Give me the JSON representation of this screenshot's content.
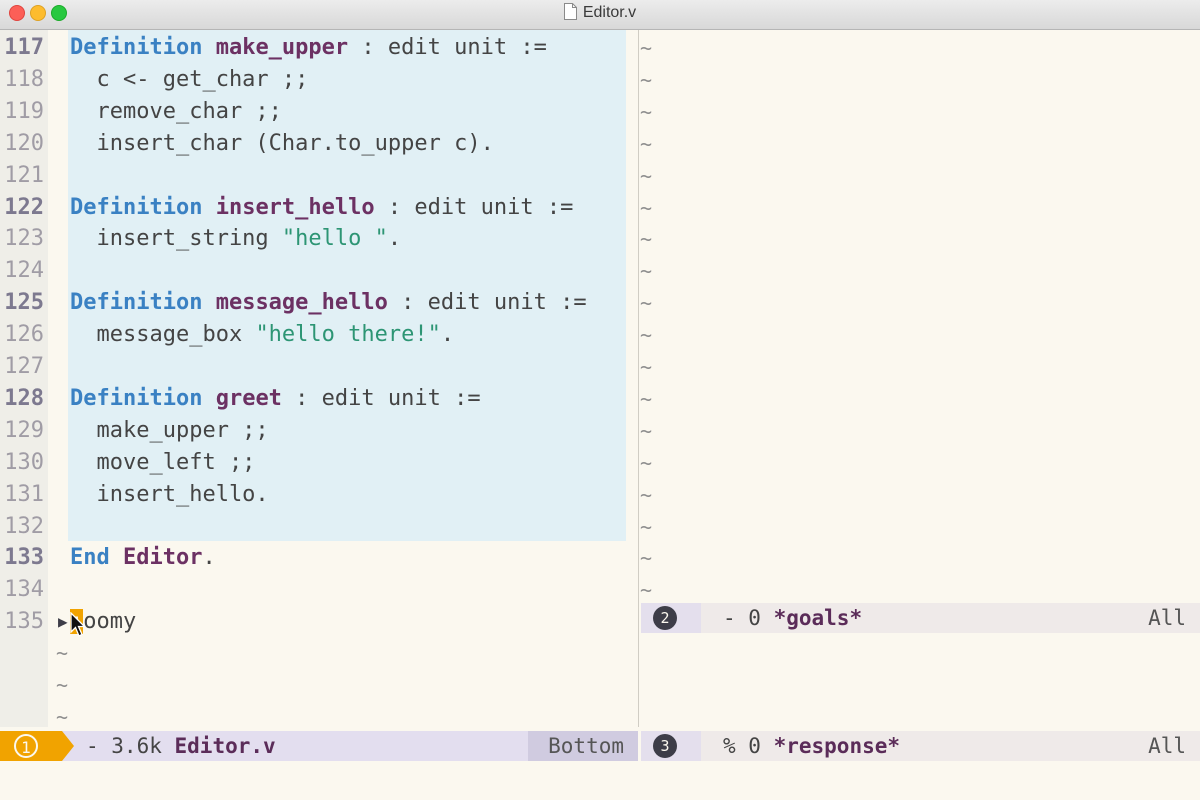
{
  "window": {
    "title": "Editor.v"
  },
  "editor": {
    "lines": [
      {
        "num": "117",
        "bold": true,
        "parts": [
          [
            "kw",
            "Definition"
          ],
          [
            "",
            " "
          ],
          [
            "nm",
            "make_upper"
          ],
          [
            "",
            " : edit unit :="
          ]
        ]
      },
      {
        "num": "118",
        "bold": false,
        "parts": [
          [
            "",
            "  c <- get_char ;;"
          ]
        ]
      },
      {
        "num": "119",
        "bold": false,
        "parts": [
          [
            "",
            "  remove_char ;;"
          ]
        ]
      },
      {
        "num": "120",
        "bold": false,
        "parts": [
          [
            "",
            "  insert_char (Char.to_upper c)."
          ]
        ]
      },
      {
        "num": "121",
        "bold": false,
        "parts": []
      },
      {
        "num": "122",
        "bold": true,
        "parts": [
          [
            "kw",
            "Definition"
          ],
          [
            "",
            " "
          ],
          [
            "nm",
            "insert_hello"
          ],
          [
            "",
            " : edit unit :="
          ]
        ]
      },
      {
        "num": "123",
        "bold": false,
        "parts": [
          [
            "",
            "  insert_string "
          ],
          [
            "str",
            "\"hello \""
          ],
          [
            "",
            "."
          ]
        ]
      },
      {
        "num": "124",
        "bold": false,
        "parts": []
      },
      {
        "num": "125",
        "bold": true,
        "parts": [
          [
            "kw",
            "Definition"
          ],
          [
            "",
            " "
          ],
          [
            "nm",
            "message_hello"
          ],
          [
            "",
            " : edit unit :="
          ]
        ]
      },
      {
        "num": "126",
        "bold": false,
        "parts": [
          [
            "",
            "  message_box "
          ],
          [
            "str",
            "\"hello there!\""
          ],
          [
            "",
            "."
          ]
        ]
      },
      {
        "num": "127",
        "bold": false,
        "parts": []
      },
      {
        "num": "128",
        "bold": true,
        "parts": [
          [
            "kw",
            "Definition"
          ],
          [
            "",
            " "
          ],
          [
            "nm",
            "greet"
          ],
          [
            "",
            " : edit unit :="
          ]
        ]
      },
      {
        "num": "129",
        "bold": false,
        "parts": [
          [
            "",
            "  make_upper ;;"
          ]
        ]
      },
      {
        "num": "130",
        "bold": false,
        "parts": [
          [
            "",
            "  move_left ;;"
          ]
        ]
      },
      {
        "num": "131",
        "bold": false,
        "parts": [
          [
            "",
            "  insert_hello."
          ]
        ]
      },
      {
        "num": "132",
        "bold": false,
        "parts": []
      },
      {
        "num": "133",
        "bold": true,
        "parts": [
          [
            "kw",
            "End"
          ],
          [
            "",
            " "
          ],
          [
            "nm",
            "Editor"
          ],
          [
            "",
            "."
          ]
        ]
      },
      {
        "num": "134",
        "bold": false,
        "parts": []
      },
      {
        "num": "135",
        "bold": false,
        "parts": [
          [
            "cursor",
            ":"
          ],
          [
            "",
            "oomy"
          ]
        ]
      }
    ],
    "empty_marker": "~"
  },
  "modeline_left": {
    "window_number": "1",
    "info": "- 3.6k",
    "buffer_name": "Editor.v",
    "position": "Bottom"
  },
  "modeline_goals": {
    "window_number": "2",
    "info": "- 0",
    "buffer_name": "*goals*",
    "position": "All"
  },
  "modeline_response": {
    "window_number": "3",
    "info": "% 0",
    "buffer_name": "*response*",
    "position": "All"
  }
}
